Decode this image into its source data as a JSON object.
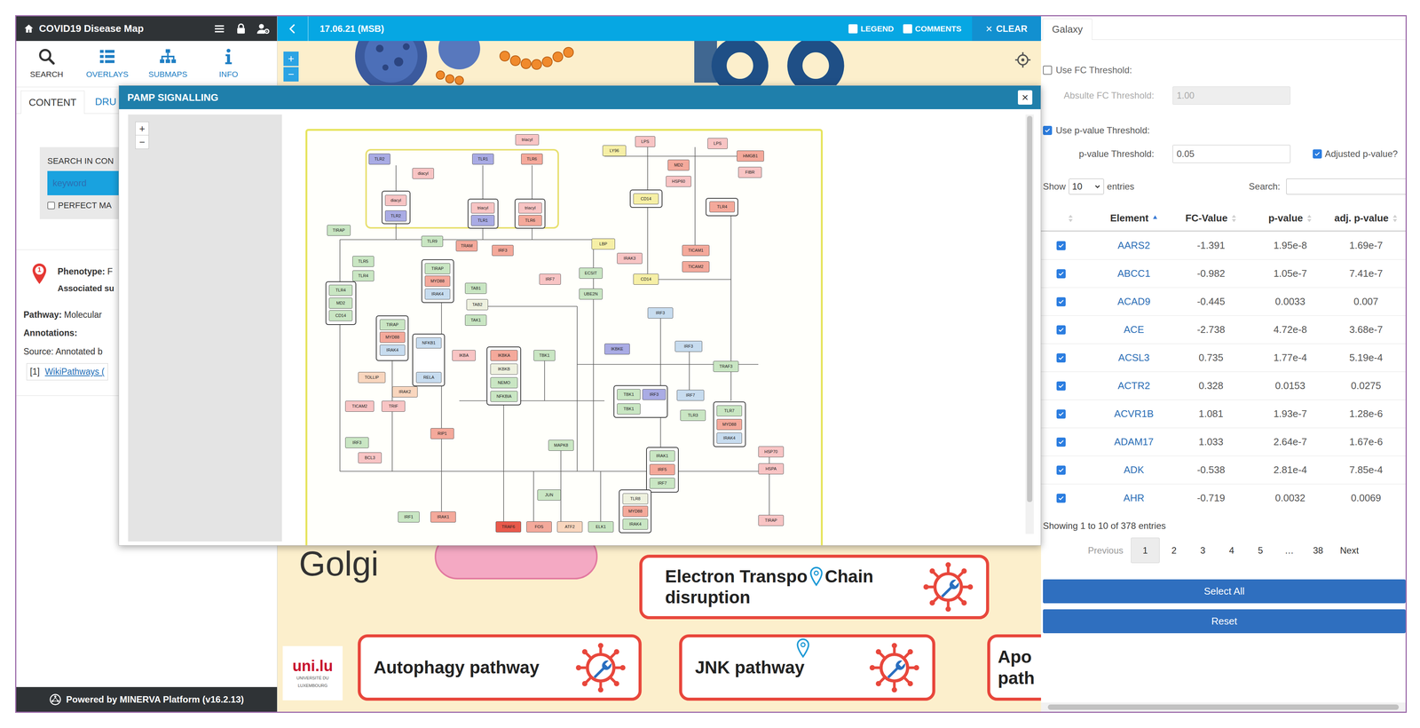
{
  "left_panel": {
    "header": {
      "title": "COVID19 Disease Map"
    },
    "icon_tabs": [
      {
        "label": "SEARCH",
        "selected": true
      },
      {
        "label": "OVERLAYS",
        "selected": false
      },
      {
        "label": "SUBMAPS",
        "selected": false
      },
      {
        "label": "INFO",
        "selected": false
      }
    ],
    "sub_tabs": [
      {
        "label": "CONTENT",
        "selected": true
      },
      {
        "label": "DRU",
        "selected": false
      }
    ],
    "search": {
      "label": "SEARCH IN CON",
      "placeholder": "keyword",
      "perfect_match": {
        "label": "PERFECT MA",
        "checked": false
      }
    },
    "result": {
      "index": "1",
      "phenotype": {
        "label": "Phenotype:",
        "value": "F"
      },
      "associated": "Associated su",
      "pathway": {
        "label": "Pathway:",
        "value": "Molecular"
      },
      "annotations": "Annotations:",
      "source": "Source: Annotated b",
      "reference": {
        "index": "[1]",
        "link": "WikiPathways ("
      }
    },
    "footer": "Powered by MINERVA Platform (v16.2.13)"
  },
  "map": {
    "toolbar": {
      "date": "17.06.21 (MSB)",
      "legend": {
        "label": "LEGEND",
        "checked": false
      },
      "comments": {
        "label": "COMMENTS",
        "checked": false
      },
      "clear": {
        "icon": "×",
        "label": "CLEAR"
      }
    },
    "zoom": {
      "in": "+",
      "out": "−"
    },
    "compartment": "Golgi",
    "cards": [
      {
        "lines": [
          [
            "Electron Transpo",
            "Chain"
          ],
          [
            "disruption"
          ]
        ],
        "pin": "inline"
      },
      {
        "lines": [
          [
            "Autophagy pathway"
          ]
        ],
        "pin": "none"
      },
      {
        "lines": [
          [
            "JNK pathway"
          ]
        ],
        "pin": "above"
      },
      {
        "lines": [
          [
            "Apo"
          ],
          [
            "path"
          ]
        ],
        "pin": "none"
      }
    ],
    "logo": {
      "name": "uni.lu",
      "lines": [
        "UNIVERSITÉ DU",
        "LUXEMBOURG"
      ]
    }
  },
  "modal": {
    "title": "PAMP SIGNALLING",
    "close": "×",
    "zoom": {
      "in": "+",
      "out": "−"
    },
    "diagram": {
      "nodes": [
        {
          "label": "TLR2",
          "color": "#a9abe4"
        },
        {
          "label": "diacyl",
          "color": "#f8c4c4"
        },
        {
          "label": "TLR1",
          "color": "#a9abe4"
        },
        {
          "label": "triacyl",
          "color": "#f8c4c4"
        },
        {
          "label": "TLR6",
          "color": "#f4a99b"
        },
        {
          "label": "diacyl",
          "color": "#f8c4c4"
        },
        {
          "label": "TLR2",
          "color": "#a9abe4"
        },
        {
          "label": "triacyl",
          "color": "#f8c4c4"
        },
        {
          "label": "TLR1",
          "color": "#a9abe4"
        },
        {
          "label": "triacyl",
          "color": "#f8c4c4"
        },
        {
          "label": "TLR6",
          "color": "#f4a99b"
        },
        {
          "label": "TIRAP",
          "color": "#c9e6c3"
        },
        {
          "label": "TLR5",
          "color": "#c9e6c3"
        },
        {
          "label": "TLR4",
          "color": "#c9e6c3"
        },
        {
          "label": "TLR4",
          "color": "#c9e6c3"
        },
        {
          "label": "MD2",
          "color": "#c9e6c3"
        },
        {
          "label": "CD14",
          "color": "#c9e6c3"
        },
        {
          "label": "TIRAP",
          "color": "#c9e6c3"
        },
        {
          "label": "MYD88",
          "color": "#f4a99b"
        },
        {
          "label": "IRAK4",
          "color": "#c7dcef"
        },
        {
          "label": "TLR9",
          "color": "#c9e6c3"
        },
        {
          "label": "TRAM",
          "color": "#f4a99b"
        },
        {
          "label": "TIRAP",
          "color": "#c9e6c3"
        },
        {
          "label": "MYD88",
          "color": "#f4a99b"
        },
        {
          "label": "IRAK4",
          "color": "#c7dcef"
        },
        {
          "label": "IRF3",
          "color": "#f4a99b"
        },
        {
          "label": "IRF7",
          "color": "#f8c4c4"
        },
        {
          "label": "TAB1",
          "color": "#c9e6c3"
        },
        {
          "label": "TAB2",
          "color": "#eef1df"
        },
        {
          "label": "TAK1",
          "color": "#c9e6c3"
        },
        {
          "label": "IKBKA",
          "color": "#f4a99b"
        },
        {
          "label": "IKBKB",
          "color": "#eef1df"
        },
        {
          "label": "NEMO",
          "color": "#c9e6c3"
        },
        {
          "label": "NFKBIA",
          "color": "#c9e6c3"
        },
        {
          "label": "TBK1",
          "color": "#c9e6c3"
        },
        {
          "label": "NFKB1",
          "color": "#c7dcef"
        },
        {
          "label": "RELA",
          "color": "#c7dcef"
        },
        {
          "label": "IKBA",
          "color": "#f8c4c4"
        },
        {
          "label": "TOLLIP",
          "color": "#f9d6be"
        },
        {
          "label": "IRAK2",
          "color": "#f9d6be"
        },
        {
          "label": "ECSIT",
          "color": "#c9e6c3"
        },
        {
          "label": "UBE2N",
          "color": "#c9e6c3"
        },
        {
          "label": "LY96",
          "color": "#f6efa6"
        },
        {
          "label": "LPS",
          "color": "#f8c4c4"
        },
        {
          "label": "CD14",
          "color": "#f6efa6"
        },
        {
          "label": "MD2",
          "color": "#f4a99b"
        },
        {
          "label": "HSP60",
          "color": "#f8c4c4"
        },
        {
          "label": "LPS",
          "color": "#f8c4c4"
        },
        {
          "label": "HMGB1",
          "color": "#f4a99b"
        },
        {
          "label": "FIBR",
          "color": "#f8c4c4"
        },
        {
          "label": "TLR4",
          "color": "#f4a99b"
        },
        {
          "label": "LBP",
          "color": "#f6efa6"
        },
        {
          "label": "IRAK3",
          "color": "#f8c4c4"
        },
        {
          "label": "TICAM1",
          "color": "#f4a99b"
        },
        {
          "label": "TICAM2",
          "color": "#f4a99b"
        },
        {
          "label": "CD14",
          "color": "#f6efa6"
        },
        {
          "label": "IRF3",
          "color": "#c7dcef"
        },
        {
          "label": "IKBKE",
          "color": "#a9abe4"
        },
        {
          "label": "IRF3",
          "color": "#c7dcef"
        },
        {
          "label": "TRAF3",
          "color": "#c9e6c3"
        },
        {
          "label": "TBK1",
          "color": "#c9e6c3"
        },
        {
          "label": "IRF3",
          "color": "#a9abe4"
        },
        {
          "label": "TBK1",
          "color": "#c9e6c3"
        },
        {
          "label": "IRF7",
          "color": "#c7dcef"
        },
        {
          "label": "TLR3",
          "color": "#c9e6c3"
        },
        {
          "label": "TLR7",
          "color": "#c9e6c3"
        },
        {
          "label": "MYD88",
          "color": "#f4a99b"
        },
        {
          "label": "IRAK4",
          "color": "#c7dcef"
        },
        {
          "label": "HSP70",
          "color": "#f8c4c4"
        },
        {
          "label": "HSPA",
          "color": "#f8c4c4"
        },
        {
          "label": "IRAK1",
          "color": "#c9e6c3"
        },
        {
          "label": "IRF5",
          "color": "#f4a99b"
        },
        {
          "label": "IRF7",
          "color": "#c9e6c3"
        },
        {
          "label": "MAPK8",
          "color": "#c9e6c3"
        },
        {
          "label": "JUN",
          "color": "#c9e6c3"
        },
        {
          "label": "TRAF6",
          "color": "#e9594b"
        },
        {
          "label": "FOS",
          "color": "#f4a99b"
        },
        {
          "label": "ATF2",
          "color": "#f9d6be"
        },
        {
          "label": "ELK1",
          "color": "#c9e6c3"
        },
        {
          "label": "IRF1",
          "color": "#c9e6c3"
        },
        {
          "label": "IRAK1",
          "color": "#f4a99b"
        },
        {
          "label": "RIP1",
          "color": "#f4a99b"
        },
        {
          "label": "TICAM2",
          "color": "#f8c4c4"
        },
        {
          "label": "TRIF",
          "color": "#f8c4c4"
        },
        {
          "label": "IRF3",
          "color": "#c9e6c3"
        },
        {
          "label": "BCL3",
          "color": "#f8c4c4"
        },
        {
          "label": "TIRAP",
          "color": "#f8c4c4"
        },
        {
          "label": "TLR8",
          "color": "#eef1df"
        },
        {
          "label": "MYD88",
          "color": "#f4a99b"
        },
        {
          "label": "IRAK4",
          "color": "#c9e6c3"
        }
      ]
    }
  },
  "right_panel": {
    "tabs": [
      {
        "label": "Galaxy",
        "selected": true
      }
    ],
    "fc_toggle": {
      "label": "Use FC Threshold:",
      "checked": false
    },
    "fc_threshold": {
      "label": "Absulte FC Threshold:",
      "value": "1.00",
      "disabled": true
    },
    "p_toggle": {
      "label": "Use p-value Threshold:",
      "checked": true
    },
    "p_threshold": {
      "label": "p-value Threshold:",
      "value": "0.05",
      "disabled": false
    },
    "adjusted": {
      "label": "Adjusted p-value?",
      "checked": true
    },
    "length": {
      "prefix": "Show",
      "value": "10",
      "suffix": "entries"
    },
    "search": {
      "label": "Search:",
      "value": ""
    },
    "table": {
      "columns": [
        {
          "sort": "none"
        },
        {
          "label": "Element",
          "sort": "asc"
        },
        {
          "label": "FC-Value",
          "sort": "none"
        },
        {
          "label": "p-value",
          "sort": "none"
        },
        {
          "label": "adj. p-value",
          "sort": "none"
        }
      ],
      "rows": [
        {
          "checked": true,
          "cells": [
            "AARS2",
            "-1.391",
            "1.95e-8",
            "1.69e-7"
          ]
        },
        {
          "checked": true,
          "cells": [
            "ABCC1",
            "-0.982",
            "1.05e-7",
            "7.41e-7"
          ]
        },
        {
          "checked": true,
          "cells": [
            "ACAD9",
            "-0.445",
            "0.0033",
            "0.007"
          ]
        },
        {
          "checked": true,
          "cells": [
            "ACE",
            "-2.738",
            "4.72e-8",
            "3.68e-7"
          ]
        },
        {
          "checked": true,
          "cells": [
            "ACSL3",
            "0.735",
            "1.77e-4",
            "5.19e-4"
          ]
        },
        {
          "checked": true,
          "cells": [
            "ACTR2",
            "0.328",
            "0.0153",
            "0.0275"
          ]
        },
        {
          "checked": true,
          "cells": [
            "ACVR1B",
            "1.081",
            "1.93e-7",
            "1.28e-6"
          ]
        },
        {
          "checked": true,
          "cells": [
            "ADAM17",
            "1.033",
            "2.64e-7",
            "1.67e-6"
          ]
        },
        {
          "checked": true,
          "cells": [
            "ADK",
            "-0.538",
            "2.81e-4",
            "7.85e-4"
          ]
        },
        {
          "checked": true,
          "cells": [
            "AHR",
            "-0.719",
            "0.0032",
            "0.0069"
          ]
        }
      ]
    },
    "info": "Showing 1 to 10 of 378 entries",
    "pagination": {
      "previous": {
        "label": "Previous",
        "disabled": true
      },
      "pages": [
        {
          "label": "1",
          "selected": true
        },
        {
          "label": "2",
          "selected": false
        },
        {
          "label": "3",
          "selected": false
        },
        {
          "label": "4",
          "selected": false
        },
        {
          "label": "5",
          "selected": false
        },
        {
          "label": "…",
          "selected": false
        },
        {
          "label": "38",
          "selected": false
        }
      ],
      "next": {
        "label": "Next",
        "disabled": false
      }
    },
    "buttons": [
      "Select All",
      "Reset"
    ]
  }
}
